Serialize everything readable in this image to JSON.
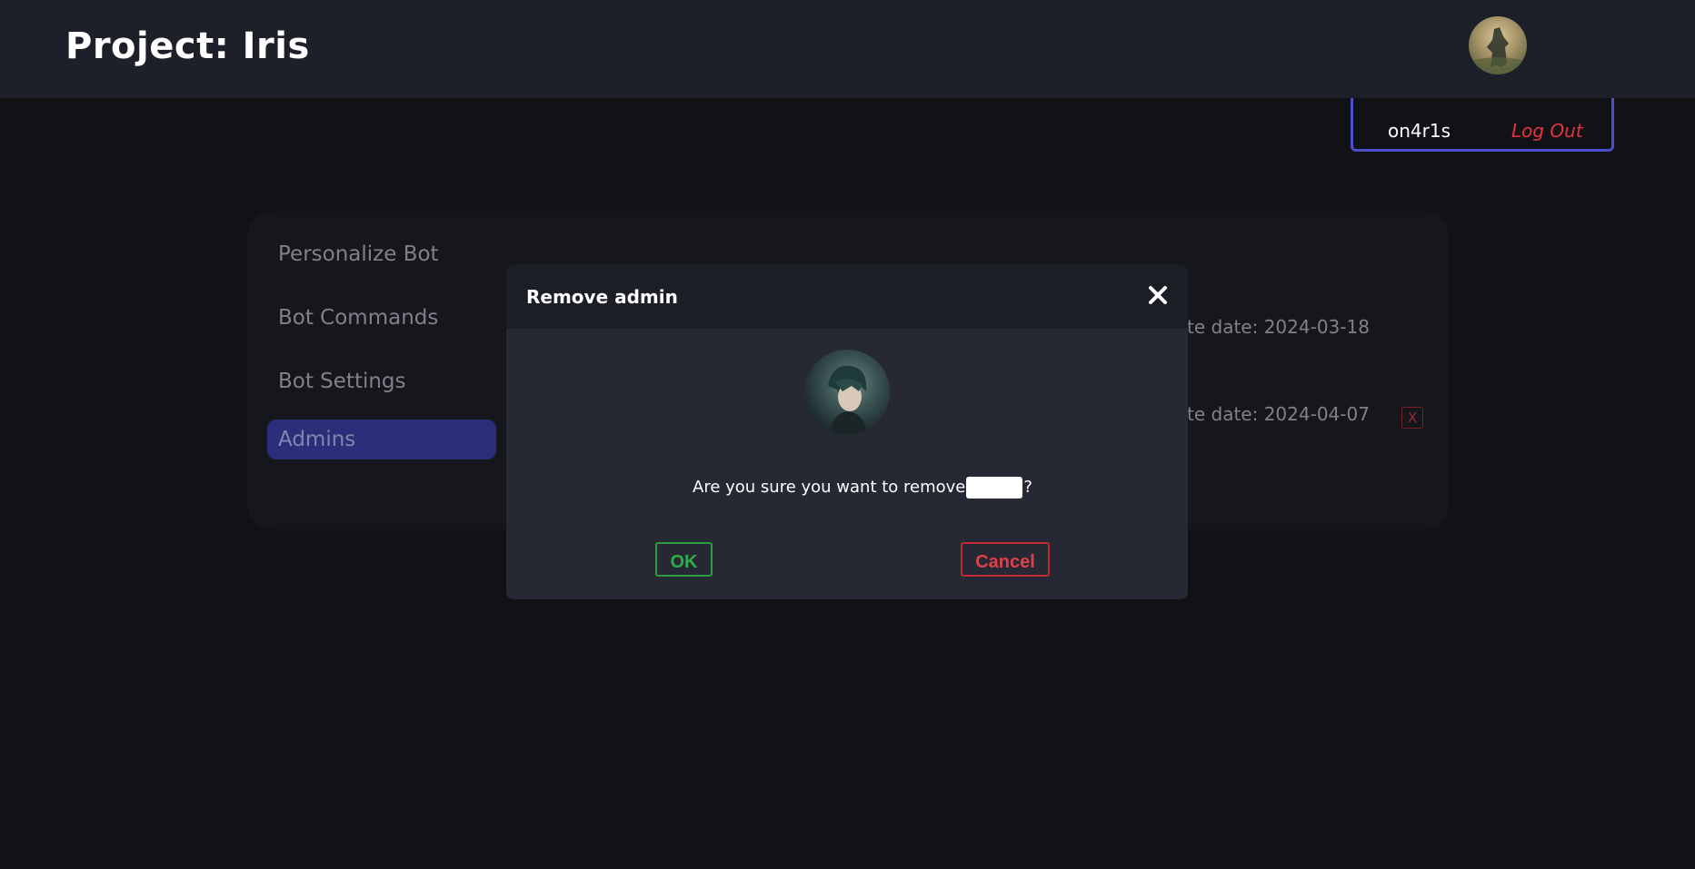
{
  "header": {
    "title": "Project: Iris"
  },
  "user_menu": {
    "username": "on4r1s",
    "logout_label": "Log Out"
  },
  "sidebar": {
    "items": [
      {
        "label": "Personalize Bot",
        "active": false
      },
      {
        "label": "Bot Commands",
        "active": false
      },
      {
        "label": "Bot Settings",
        "active": false
      },
      {
        "label": "Admins",
        "active": true
      }
    ]
  },
  "admins": {
    "rows": [
      {
        "date_text": "te date: 2024-03-18"
      },
      {
        "date_text": "te date: 2024-04-07",
        "remove_label": "X"
      }
    ]
  },
  "modal": {
    "title": "Remove admin",
    "message_prefix": "Are you sure you want to remove",
    "message_suffix": "?",
    "ok_label": "OK",
    "cancel_label": "Cancel"
  },
  "colors": {
    "background": "#111116",
    "topbar": "#1e2029",
    "accent": "#4c4fc7",
    "danger": "#e5343f",
    "success": "#2fae47"
  }
}
